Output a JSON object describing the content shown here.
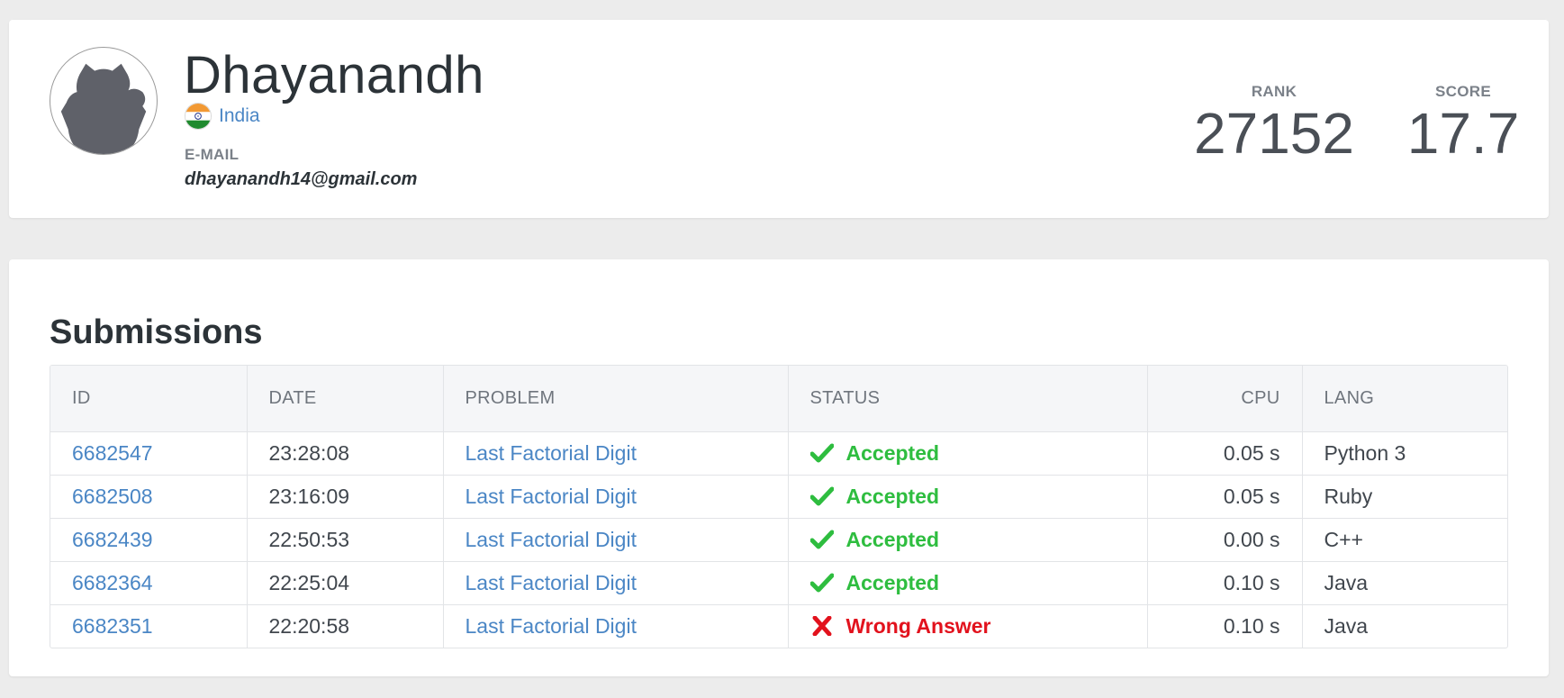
{
  "profile": {
    "name": "Dhayanandh",
    "country": "India",
    "email_label": "E-MAIL",
    "email": "dhayanandh14@gmail.com",
    "avatar_icon": "cat-silhouette-icon",
    "flag_icon": "india-flag-icon"
  },
  "stats": {
    "rank_label": "RANK",
    "rank_value": "27152",
    "score_label": "SCORE",
    "score_value": "17.7"
  },
  "submissions": {
    "title": "Submissions",
    "headers": {
      "id": "ID",
      "date": "DATE",
      "problem": "PROBLEM",
      "status": "STATUS",
      "cpu": "CPU",
      "lang": "LANG"
    },
    "rows": [
      {
        "id": "6682547",
        "date": "23:28:08",
        "problem": "Last Factorial Digit",
        "status": "Accepted",
        "cpu": "0.05 s",
        "lang": "Python 3"
      },
      {
        "id": "6682508",
        "date": "23:16:09",
        "problem": "Last Factorial Digit",
        "status": "Accepted",
        "cpu": "0.05 s",
        "lang": "Ruby"
      },
      {
        "id": "6682439",
        "date": "22:50:53",
        "problem": "Last Factorial Digit",
        "status": "Accepted",
        "cpu": "0.00 s",
        "lang": "C++"
      },
      {
        "id": "6682364",
        "date": "22:25:04",
        "problem": "Last Factorial Digit",
        "status": "Accepted",
        "cpu": "0.10 s",
        "lang": "Java"
      },
      {
        "id": "6682351",
        "date": "22:20:58",
        "problem": "Last Factorial Digit",
        "status": "Wrong Answer",
        "cpu": "0.10 s",
        "lang": "Java"
      }
    ]
  },
  "colors": {
    "link": "#4a86c5",
    "accepted": "#2ebd3f",
    "wrong_answer": "#e2121d",
    "background": "#ececec"
  }
}
